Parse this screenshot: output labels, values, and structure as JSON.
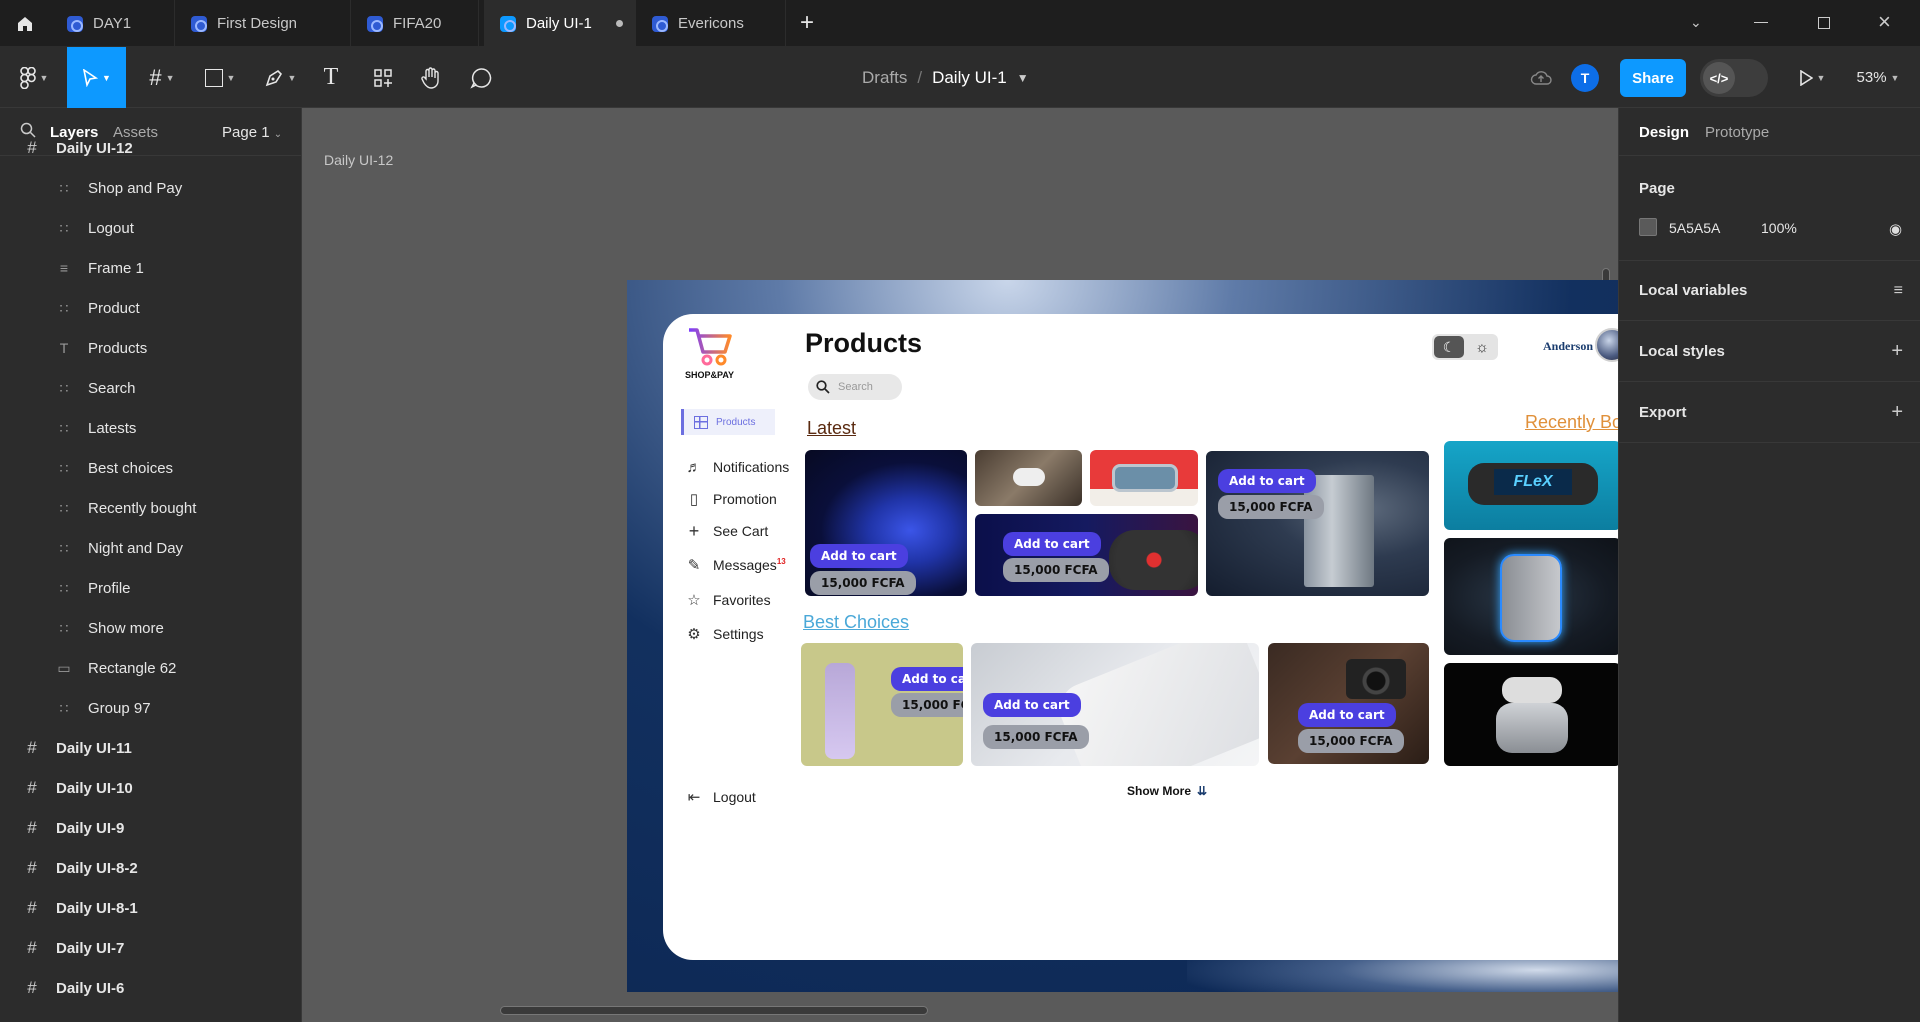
{
  "tabs": [
    {
      "label": "DAY1"
    },
    {
      "label": "First Design"
    },
    {
      "label": "FIFA20"
    },
    {
      "label": "Daily UI-1",
      "active": true
    },
    {
      "label": "Evericons"
    }
  ],
  "toolbar": {
    "breadcrumb_root": "Drafts",
    "breadcrumb_sep": "/",
    "file_name": "Daily UI-1",
    "avatar_initial": "T",
    "share_label": "Share",
    "zoom": "53%"
  },
  "left_panel": {
    "tab_layers": "Layers",
    "tab_assets": "Assets",
    "page_selector": "Page 1",
    "layers": [
      {
        "label": "Daily UI-12",
        "icon": "frame-icon",
        "level": 0
      },
      {
        "label": "Shop and Pay",
        "icon": "group-icon",
        "level": 1
      },
      {
        "label": "Logout",
        "icon": "group-icon",
        "level": 1
      },
      {
        "label": "Frame 1",
        "icon": "autolayout-icon",
        "level": 1
      },
      {
        "label": "Product",
        "icon": "group-icon",
        "level": 1
      },
      {
        "label": "Products",
        "icon": "text-icon",
        "level": 1
      },
      {
        "label": "Search",
        "icon": "group-icon",
        "level": 1
      },
      {
        "label": "Latests",
        "icon": "group-icon",
        "level": 1
      },
      {
        "label": "Best choices",
        "icon": "group-icon",
        "level": 1
      },
      {
        "label": "Recently bought",
        "icon": "group-icon",
        "level": 1
      },
      {
        "label": "Night and Day",
        "icon": "group-icon",
        "level": 1
      },
      {
        "label": "Profile",
        "icon": "group-icon",
        "level": 1
      },
      {
        "label": "Show more",
        "icon": "group-icon",
        "level": 1
      },
      {
        "label": "Rectangle 62",
        "icon": "rectangle-icon",
        "level": 1
      },
      {
        "label": "Group 97",
        "icon": "group-icon",
        "level": 1
      },
      {
        "label": "Daily UI-11",
        "icon": "frame-icon",
        "level": 0
      },
      {
        "label": "Daily UI-10",
        "icon": "frame-icon",
        "level": 0
      },
      {
        "label": "Daily UI-9",
        "icon": "frame-icon",
        "level": 0
      },
      {
        "label": "Daily UI-8-2",
        "icon": "frame-icon",
        "level": 0
      },
      {
        "label": "Daily UI-8-1",
        "icon": "frame-icon",
        "level": 0
      },
      {
        "label": "Daily UI-7",
        "icon": "frame-icon",
        "level": 0
      },
      {
        "label": "Daily UI-6",
        "icon": "frame-icon",
        "level": 0
      }
    ]
  },
  "right_panel": {
    "tab_design": "Design",
    "tab_prototype": "Prototype",
    "page_heading": "Page",
    "page_color": "5A5A5A",
    "page_opacity": "100%",
    "local_variables": "Local variables",
    "local_styles": "Local styles",
    "export": "Export"
  },
  "canvas": {
    "frame_label": "Daily UI-12",
    "help": "?"
  },
  "design": {
    "logo_text": "SHOP&PAY",
    "title": "Products",
    "user_name": "Anderson",
    "search_placeholder": "Search",
    "nav": [
      {
        "label": "Products",
        "icon": "grid-icon",
        "active": true
      },
      {
        "label": "Notifications",
        "icon": "bell-icon"
      },
      {
        "label": "Promotion",
        "icon": "ticket-icon"
      },
      {
        "label": "See Cart",
        "icon": "plus-icon"
      },
      {
        "label": "Messages",
        "icon": "message-icon",
        "badge": "13"
      },
      {
        "label": "Favorites",
        "icon": "star-icon"
      },
      {
        "label": "Settings",
        "icon": "settings-icon"
      }
    ],
    "logout": "Logout",
    "latest_heading": "Latest",
    "best_heading": "Best Choices",
    "recent_heading": "Recently Bought",
    "add_to_cart": "Add to cart",
    "price": "15,000 FCFA",
    "flex_label": "FLeX",
    "show_more": "Show More",
    "colors": {
      "accent": "#4b3fe0",
      "price_pill": "#9a9ea8",
      "recent": "#e0903a",
      "best": "#4aa8d8",
      "latest": "#5a2a10"
    }
  }
}
